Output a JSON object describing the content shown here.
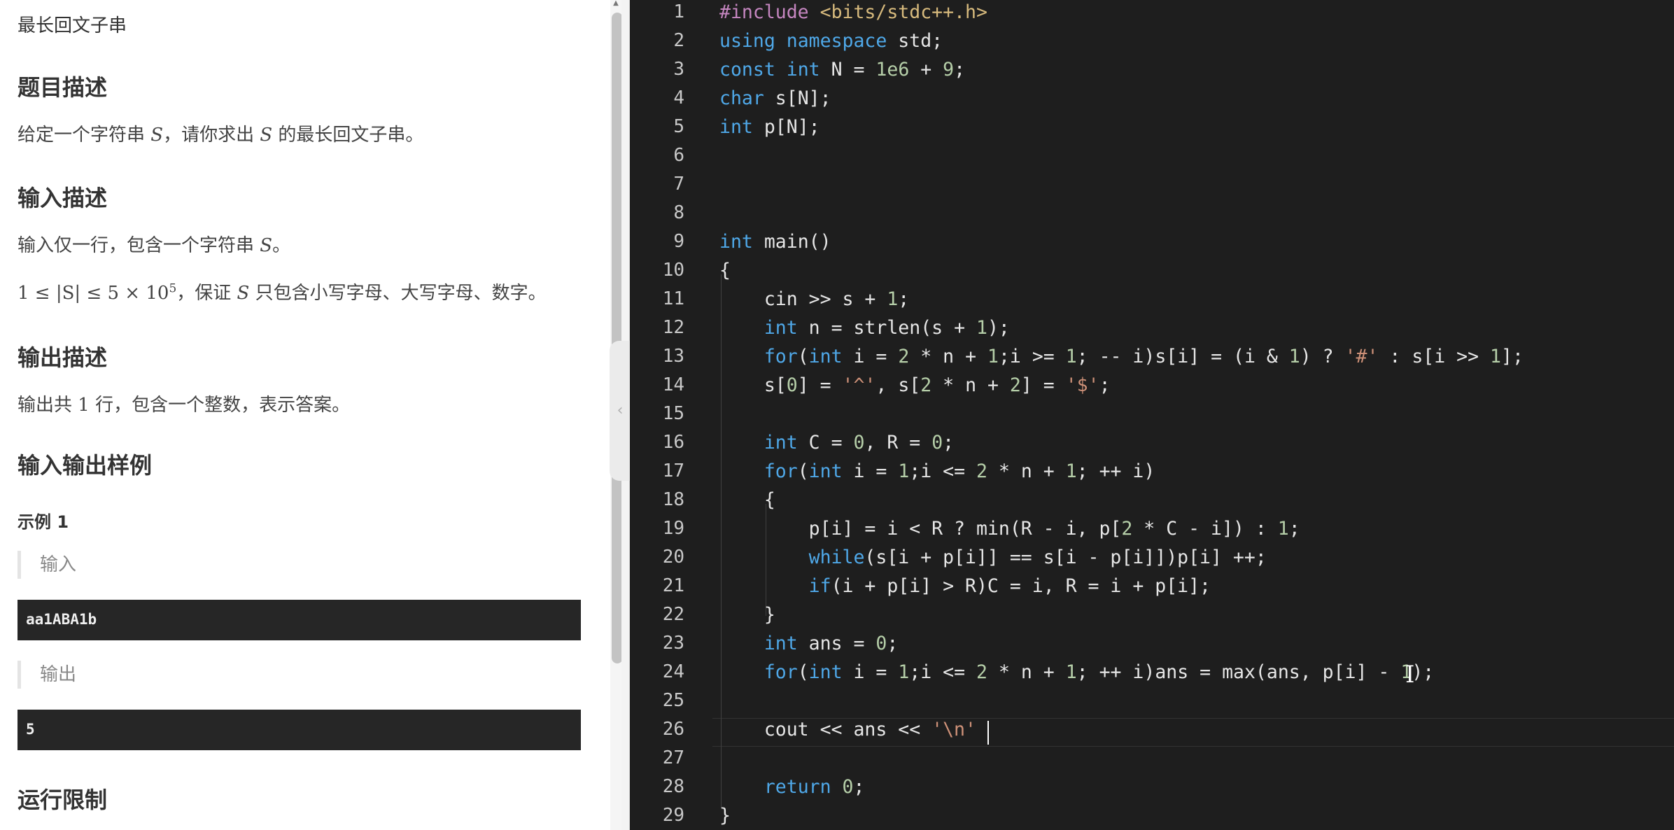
{
  "problem": {
    "title": "最长回文子串",
    "desc_heading": "题目描述",
    "desc_text_1": "给定一个字符串 ",
    "desc_var": "S",
    "desc_text_2": "，请你求出 ",
    "desc_var_2": "S",
    "desc_text_3": " 的最长回文子串。",
    "input_heading": "输入描述",
    "input_text_1": "输入仅一行，包含一个字符串 ",
    "input_var": "S",
    "input_text_2": "。",
    "constraint_math": "1 ≤ |S| ≤ 5 × 10",
    "constraint_exp": "5",
    "constraint_text_1": "，保证 ",
    "constraint_var": "S",
    "constraint_text_2": " 只包含小写字母、大写字母、数字。",
    "output_heading": "输出描述",
    "output_text_1": "输出共 ",
    "output_num": "1",
    "output_text_2": " 行，包含一个整数，表示答案。",
    "sample_heading": "输入输出样例",
    "example_label": "示例 1",
    "input_label": "输入",
    "sample_input": "aa1ABA1b",
    "output_label": "输出",
    "sample_output": "5",
    "limits_heading": "运行限制"
  },
  "editor": {
    "line_numbers": [
      "1",
      "2",
      "3",
      "4",
      "5",
      "6",
      "7",
      "8",
      "9",
      "10",
      "11",
      "12",
      "13",
      "14",
      "15",
      "16",
      "17",
      "18",
      "19",
      "20",
      "21",
      "22",
      "23",
      "24",
      "25",
      "26",
      "27",
      "28",
      "29"
    ]
  }
}
